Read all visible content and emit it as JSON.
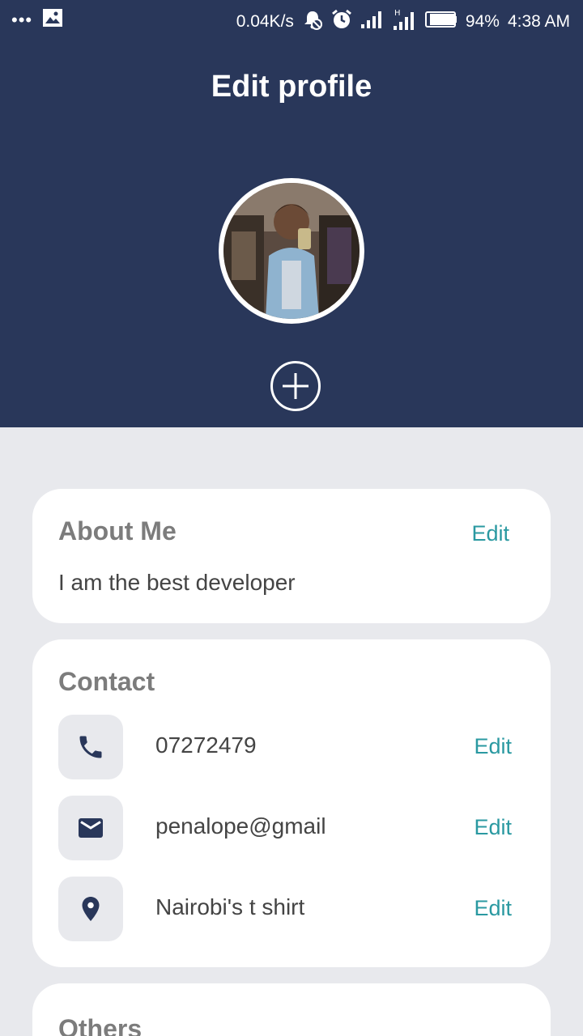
{
  "status_bar": {
    "net_speed": "0.04K/s",
    "battery": "94%",
    "time": "4:38 AM",
    "icons": [
      "more-dots-icon",
      "image-icon",
      "mute-bell-icon",
      "alarm-icon",
      "signal-icon",
      "signal-h-icon",
      "battery-icon"
    ]
  },
  "header": {
    "title": "Edit profile",
    "background": "#29375a"
  },
  "about": {
    "title": "About Me",
    "edit_label": "Edit",
    "text": "I am the best developer"
  },
  "contact": {
    "title": "Contact",
    "items": [
      {
        "icon": "phone-icon",
        "value": "07272479",
        "edit_label": "Edit"
      },
      {
        "icon": "mail-icon",
        "value": "penalope@gmail",
        "edit_label": "Edit"
      },
      {
        "icon": "location-pin-icon",
        "value": "Nairobi's t shirt",
        "edit_label": "Edit"
      }
    ]
  },
  "others": {
    "title": "Others"
  },
  "colors": {
    "accent": "#2a99a1",
    "navy": "#29375a",
    "page_bg": "#e8e9ed"
  }
}
